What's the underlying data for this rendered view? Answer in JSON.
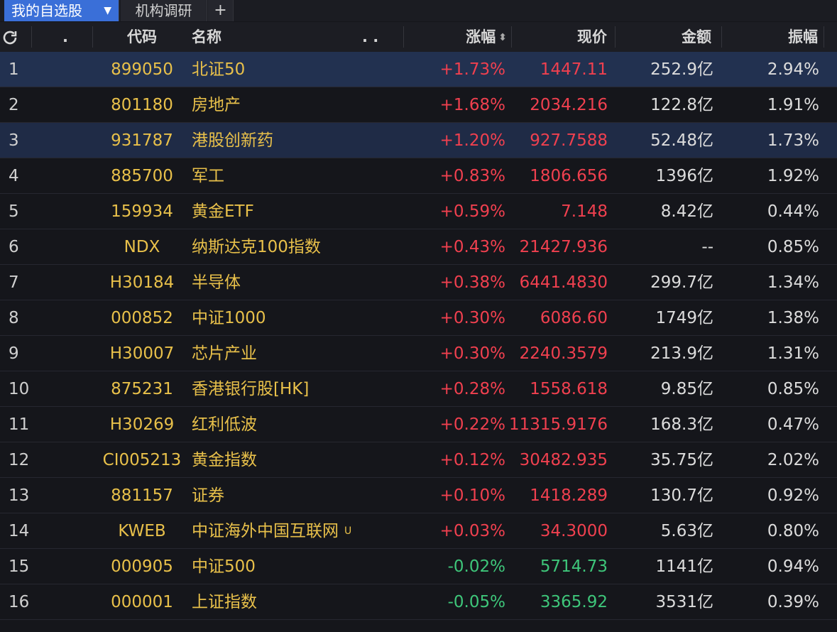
{
  "tabs": {
    "watchlist": "我的自选股",
    "research": "机构调研",
    "add": "+"
  },
  "header": {
    "dot": ".",
    "code": "代码",
    "name": "名称",
    "dots": ". .",
    "change": "涨幅",
    "sort_glyph": "⬍",
    "price": "现价",
    "amount": "金额",
    "amplitude": "振幅"
  },
  "colors": {
    "up": "#f0404f",
    "down": "#3ec67a",
    "code_name": "#e8c04a",
    "tab_active": "#3a6fd8",
    "row_highlight": "#223150"
  },
  "rows": [
    {
      "idx": "1",
      "code": "899050",
      "name": "北证50",
      "tag": "",
      "change": "+1.73%",
      "price": "1447.11",
      "amount": "252.9亿",
      "amplitude": "2.94%",
      "dir": "up",
      "hl": "hl"
    },
    {
      "idx": "2",
      "code": "801180",
      "name": "房地产",
      "tag": "",
      "change": "+1.68%",
      "price": "2034.216",
      "amount": "122.8亿",
      "amplitude": "1.91%",
      "dir": "up",
      "hl": ""
    },
    {
      "idx": "3",
      "code": "931787",
      "name": "港股创新药",
      "tag": "",
      "change": "+1.20%",
      "price": "927.7588",
      "amount": "52.48亿",
      "amplitude": "1.73%",
      "dir": "up",
      "hl": "hl2"
    },
    {
      "idx": "4",
      "code": "885700",
      "name": "军工",
      "tag": "",
      "change": "+0.83%",
      "price": "1806.656",
      "amount": "1396亿",
      "amplitude": "1.92%",
      "dir": "up",
      "hl": ""
    },
    {
      "idx": "5",
      "code": "159934",
      "name": "黄金ETF",
      "tag": "",
      "change": "+0.59%",
      "price": "7.148",
      "amount": "8.42亿",
      "amplitude": "0.44%",
      "dir": "up",
      "hl": ""
    },
    {
      "idx": "6",
      "code": "NDX",
      "name": "纳斯达克100指数",
      "tag": "",
      "change": "+0.43%",
      "price": "21427.936",
      "amount": "--",
      "amplitude": "0.85%",
      "dir": "up",
      "hl": ""
    },
    {
      "idx": "7",
      "code": "H30184",
      "name": "半导体",
      "tag": "",
      "change": "+0.38%",
      "price": "6441.4830",
      "amount": "299.7亿",
      "amplitude": "1.34%",
      "dir": "up",
      "hl": ""
    },
    {
      "idx": "8",
      "code": "000852",
      "name": "中证1000",
      "tag": "",
      "change": "+0.30%",
      "price": "6086.60",
      "amount": "1749亿",
      "amplitude": "1.38%",
      "dir": "up",
      "hl": ""
    },
    {
      "idx": "9",
      "code": "H30007",
      "name": "芯片产业",
      "tag": "",
      "change": "+0.30%",
      "price": "2240.3579",
      "amount": "213.9亿",
      "amplitude": "1.31%",
      "dir": "up",
      "hl": ""
    },
    {
      "idx": "10",
      "code": "875231",
      "name": "香港银行股[HK]",
      "tag": "",
      "change": "+0.28%",
      "price": "1558.618",
      "amount": "9.85亿",
      "amplitude": "0.85%",
      "dir": "up",
      "hl": ""
    },
    {
      "idx": "11",
      "code": "H30269",
      "name": "红利低波",
      "tag": "",
      "change": "+0.22%",
      "price": "11315.9176",
      "amount": "168.3亿",
      "amplitude": "0.47%",
      "dir": "up",
      "hl": ""
    },
    {
      "idx": "12",
      "code": "CI005213",
      "name": "黄金指数",
      "tag": "",
      "change": "+0.12%",
      "price": "30482.935",
      "amount": "35.75亿",
      "amplitude": "2.02%",
      "dir": "up",
      "hl": ""
    },
    {
      "idx": "13",
      "code": "881157",
      "name": "证券",
      "tag": "",
      "change": "+0.10%",
      "price": "1418.289",
      "amount": "130.7亿",
      "amplitude": "0.92%",
      "dir": "up",
      "hl": ""
    },
    {
      "idx": "14",
      "code": "KWEB",
      "name": "中证海外中国互联网",
      "tag": "U",
      "change": "+0.03%",
      "price": "34.3000",
      "amount": "5.63亿",
      "amplitude": "0.80%",
      "dir": "up",
      "hl": ""
    },
    {
      "idx": "15",
      "code": "000905",
      "name": "中证500",
      "tag": "",
      "change": "-0.02%",
      "price": "5714.73",
      "amount": "1141亿",
      "amplitude": "0.94%",
      "dir": "down",
      "hl": ""
    },
    {
      "idx": "16",
      "code": "000001",
      "name": "上证指数",
      "tag": "",
      "change": "-0.05%",
      "price": "3365.92",
      "amount": "3531亿",
      "amplitude": "0.39%",
      "dir": "down",
      "hl": ""
    }
  ]
}
